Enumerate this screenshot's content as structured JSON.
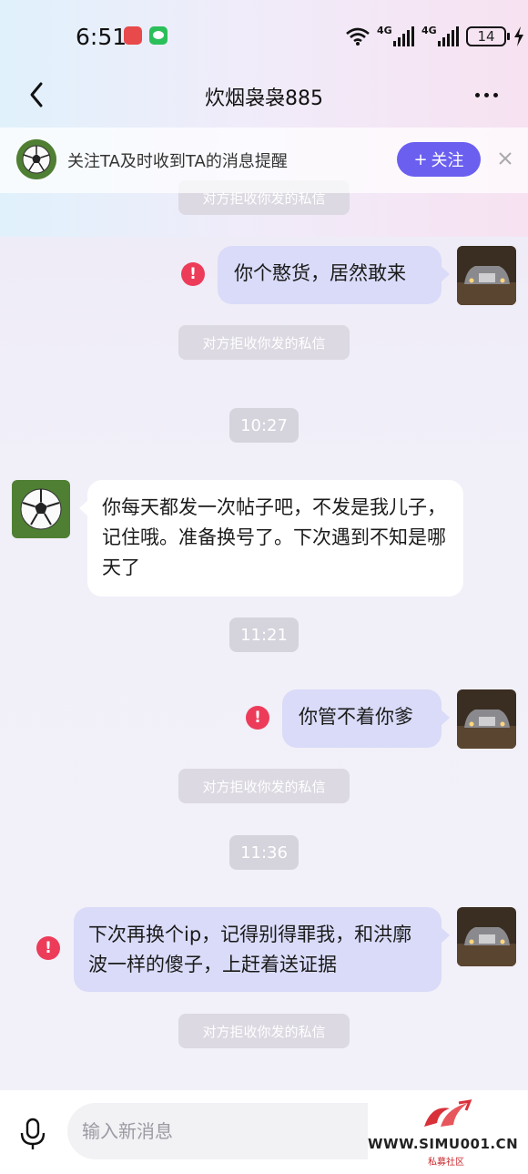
{
  "status_bar": {
    "time": "6:51",
    "network_1": "4G",
    "network_2": "4G",
    "battery": "14"
  },
  "header": {
    "title": "炊烟袅袅885"
  },
  "follow_bar": {
    "text": "关注TA及时收到TA的消息提醒",
    "button_label": "关注",
    "button_plus": "+"
  },
  "chat": {
    "notice_top": "对方拒收你发的私信",
    "messages": [
      {
        "text": "你个憨货，居然敢来",
        "failed_mark": "!",
        "notice": "对方拒收你发的私信"
      },
      {
        "timestamp": "10:27"
      },
      {
        "text": "你每天都发一次帖子吧，不发是我儿子，记住哦。准备换号了。下次遇到不知是哪天了"
      },
      {
        "timestamp": "11:21"
      },
      {
        "text": "你管不着你爹",
        "failed_mark": "!",
        "notice": "对方拒收你发的私信"
      },
      {
        "timestamp": "11:36"
      },
      {
        "text": "下次再换个ip，记得别得罪我，和洪廓波一样的傻子，上赶着送证据",
        "failed_mark": "!",
        "notice": "对方拒收你发的私信"
      }
    ]
  },
  "input": {
    "placeholder": "输入新消息"
  },
  "watermark": {
    "url": "WWW.SIMU001.CN",
    "subtitle": "私募社区"
  },
  "colors": {
    "accent": "#6b5ff0",
    "my_bubble": "#d9dbf8",
    "error": "#ec3c5a"
  }
}
